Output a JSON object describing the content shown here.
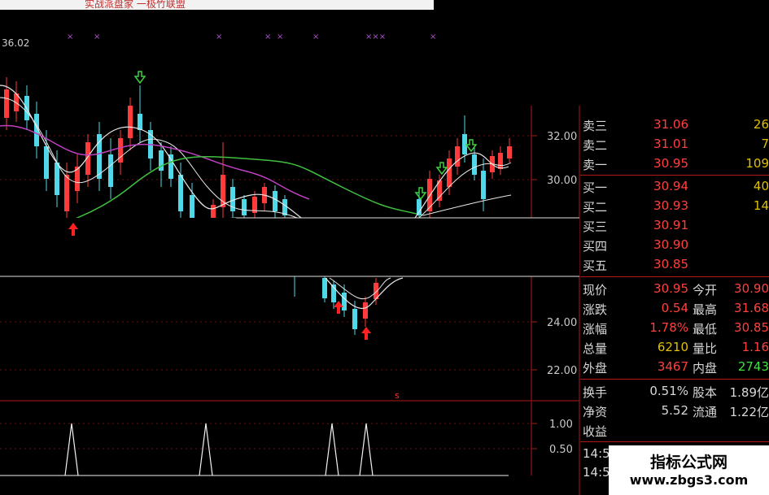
{
  "header": {
    "banner_text": "实战派盘家 一极竹联盟",
    "price_label": "36.02"
  },
  "colors": {
    "up": "#ff3b3b",
    "down": "#4fd8e8",
    "ma_white": "#e8e8e8",
    "ma_magenta": "#c040c0",
    "ma_green": "#40c040",
    "grid": "#c01818",
    "marker_purple": "#a040c0"
  },
  "price_axis": {
    "ticks": [
      "32.00",
      "30.00",
      "24.00",
      "22.00"
    ]
  },
  "indicator_axis": {
    "ticks": [
      "1.00",
      "0.50"
    ]
  },
  "quote_panel": {
    "asks": [
      {
        "label": "卖三",
        "price": "31.06",
        "volume": "26"
      },
      {
        "label": "卖二",
        "price": "31.01",
        "volume": "7"
      },
      {
        "label": "卖一",
        "price": "30.95",
        "volume": "109"
      }
    ],
    "bids": [
      {
        "label": "买一",
        "price": "30.94",
        "volume": "40"
      },
      {
        "label": "买二",
        "price": "30.93",
        "volume": "14"
      },
      {
        "label": "买三",
        "price": "30.91",
        "volume": ""
      },
      {
        "label": "买四",
        "price": "30.90",
        "volume": ""
      },
      {
        "label": "买五",
        "price": "30.85",
        "volume": ""
      }
    ],
    "stats": [
      {
        "l1": "现价",
        "v1": "30.95",
        "l2": "今开",
        "v2": "30.90"
      },
      {
        "l1": "涨跌",
        "v1": "0.54",
        "l2": "最高",
        "v2": "31.68"
      },
      {
        "l1": "涨幅",
        "v1": "1.78%",
        "l2": "最低",
        "v2": "30.85"
      },
      {
        "l1": "总量",
        "v1": "6210",
        "l2": "量比",
        "v2": "1.16"
      },
      {
        "l1": "外盘",
        "v1": "3467",
        "l2": "内盘",
        "v2": "2743"
      },
      {
        "l1": "换手",
        "v1": "0.51%",
        "l2": "股本",
        "v2": "1.89亿"
      },
      {
        "l1": "净资",
        "v1": "5.52",
        "l2": "流通",
        "v2": "1.22亿"
      },
      {
        "l1": "收益",
        "v1": "",
        "l2": "",
        "v2": ""
      }
    ],
    "times": [
      "14:5",
      "14:5"
    ]
  },
  "watermark": {
    "title": "指标公式网",
    "url": "www.zbgs3.com"
  }
}
